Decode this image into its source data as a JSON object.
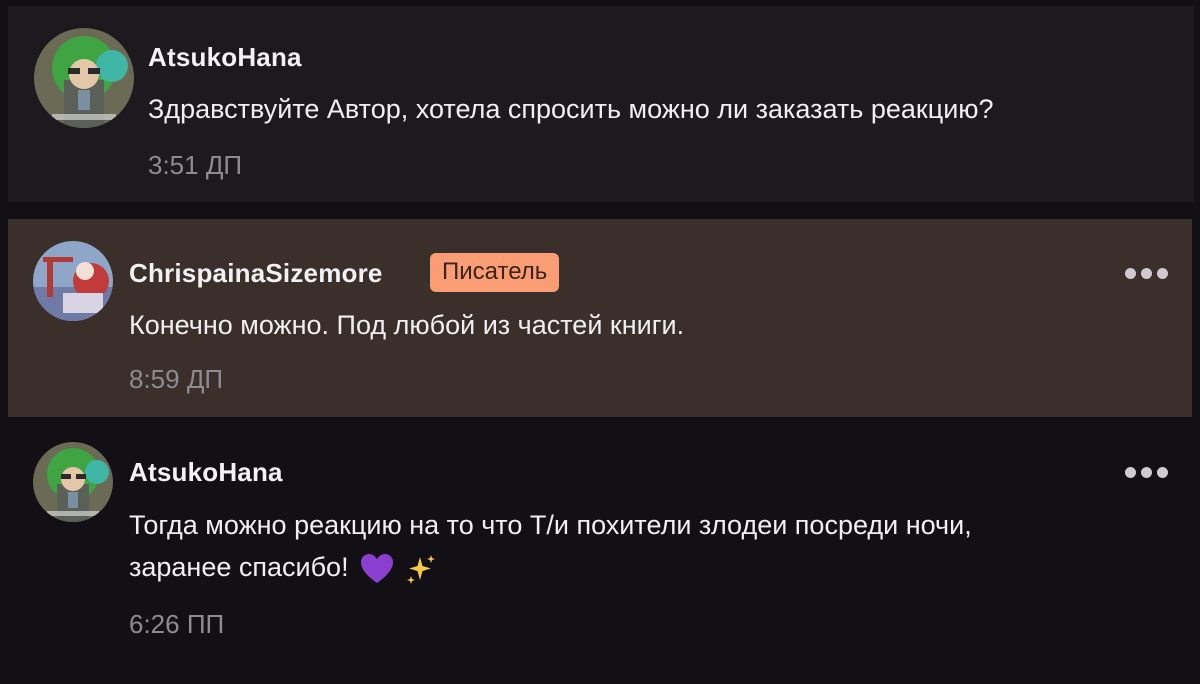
{
  "comments": [
    {
      "username": "AtsukoHana",
      "message": "Здравствуйте Автор, хотела спросить можно ли заказать реакцию?",
      "time": "3:51 ДП"
    },
    {
      "username": "ChrispainaSizemore",
      "badge": "Писатель",
      "message": "Конечно можно. Под любой из частей книги.",
      "time": "8:59 ДП"
    },
    {
      "username": "AtsukoHana",
      "message_line1": "Тогда можно реакцию на то что Т/и похители злодеи посреди ночи,",
      "message_line2": "заранее спасибо!",
      "emoji": [
        "purple-heart-icon",
        "sparkles-icon"
      ],
      "time": "6:26 ПП"
    }
  ],
  "colors": {
    "background": "#121014",
    "comment1_bg": "#1c1a1e",
    "author_comment_bg": "#3b2f2c",
    "badge_bg": "#fb9d74",
    "text": "#f1eff2",
    "time": "#8d8a90"
  }
}
